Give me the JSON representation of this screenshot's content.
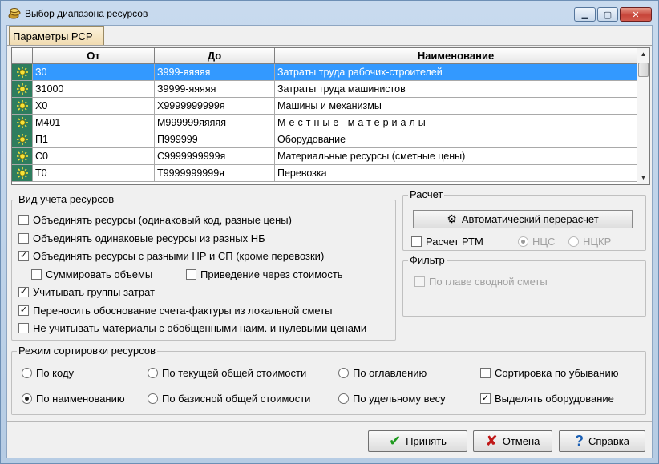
{
  "window": {
    "title": "Выбор диапазона ресурсов"
  },
  "titlebar": {
    "min": "▬",
    "max": "▢",
    "close": "✕"
  },
  "tab": {
    "label": "Параметры РСР"
  },
  "grid": {
    "columns": [
      "От",
      "До",
      "Наименование"
    ],
    "rows": [
      {
        "from": "З0",
        "to": "З999-яяяяя",
        "name": "Затраты труда рабочих-строителей"
      },
      {
        "from": "З1000",
        "to": "З9999-яяяяя",
        "name": "Затраты труда машинистов"
      },
      {
        "from": "Х0",
        "to": "Х9999999999я",
        "name": "Машины и механизмы"
      },
      {
        "from": "М401",
        "to": "М999999яяяяя",
        "name": "Местные материалы"
      },
      {
        "from": "П1",
        "to": "П999999",
        "name": "Оборудование"
      },
      {
        "from": "С0",
        "to": "С9999999999я",
        "name": "Материальные ресурсы (сметные цены)"
      },
      {
        "from": "Т0",
        "to": "Т9999999999я",
        "name": "Перевозка"
      }
    ]
  },
  "account": {
    "title": "Вид учета ресурсов",
    "opt1": "Объединять ресурсы (одинаковый код, разные цены)",
    "opt2": "Объединять одинаковые ресурсы из разных НБ",
    "opt3": "Объединять ресурсы с разными НР и СП (кроме перевозки)",
    "opt4": "Суммировать объемы",
    "opt5": "Приведение через стоимость",
    "opt6": "Учитывать группы затрат",
    "opt7": "Переносить обоснование счета-фактуры из локальной сметы",
    "opt8": "Не учитывать материалы с обобщенными наим. и нулевыми ценами"
  },
  "calc": {
    "title": "Расчет",
    "auto_button": "Автоматический перерасчет",
    "rtm": "Расчет РТМ",
    "nds": "НЦС",
    "ndkr": "НЦКР"
  },
  "filter": {
    "title": "Фильтр",
    "by_chapter": "По главе сводной сметы"
  },
  "sort": {
    "title": "Режим сортировки ресурсов",
    "by_code": "По коду",
    "by_current_cost": "По текущей общей стоимости",
    "by_toc": "По оглавлению",
    "by_name": "По наименованию",
    "by_base_cost": "По базисной общей стоимости",
    "by_unit_weight": "По удельному весу",
    "descending": "Сортировка по убыванию",
    "highlight_equipment": "Выделять оборудование"
  },
  "buttons": {
    "accept": "Принять",
    "cancel": "Отмена",
    "help": "Справка"
  },
  "colors": {
    "selection": "#3399ff",
    "icon_bg": "#2e7d5e",
    "accept_check": "#1e9a1e",
    "cancel_x": "#c01818",
    "help_q": "#1a5fb4"
  }
}
